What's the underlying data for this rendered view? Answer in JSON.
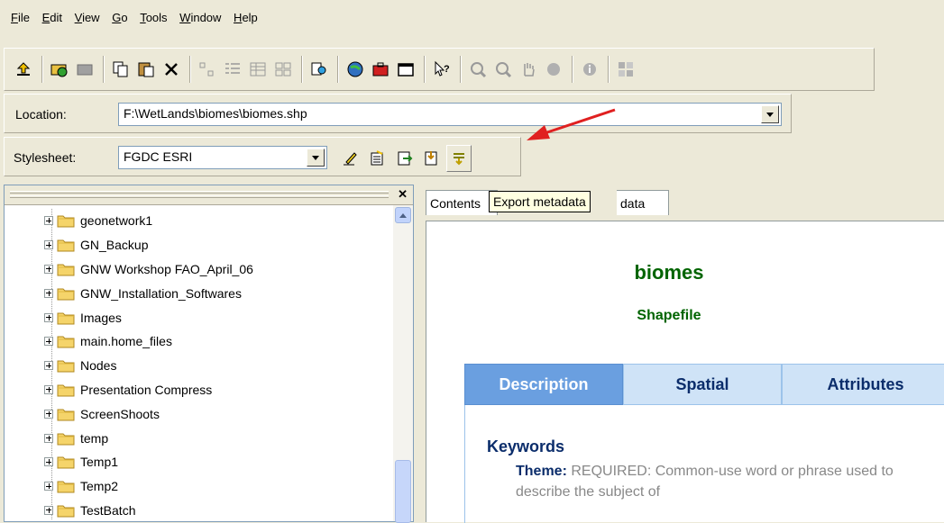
{
  "menu": [
    "File",
    "Edit",
    "View",
    "Go",
    "Tools",
    "Window",
    "Help"
  ],
  "location": {
    "label": "Location:",
    "value": "F:\\WetLands\\biomes\\biomes.shp"
  },
  "stylesheet": {
    "label": "Stylesheet:",
    "value": "FGDC ESRI"
  },
  "tooltip": "Export metadata",
  "tree": {
    "items": [
      "geonetwork1",
      "GN_Backup",
      "GNW Workshop FAO_April_06",
      "GNW_Installation_Softwares",
      "Images",
      "main.home_files",
      "Nodes",
      "Presentation Compress",
      "ScreenShoots",
      "temp",
      "Temp1",
      "Temp2",
      "TestBatch"
    ]
  },
  "tabs": {
    "contents": "Contents",
    "metadata_tail": "data"
  },
  "document": {
    "title": "biomes",
    "subtitle": "Shapefile",
    "tabs": [
      "Description",
      "Spatial",
      "Attributes"
    ],
    "section": "Keywords",
    "theme_label": "Theme:",
    "theme_text": "REQUIRED: Common-use word or phrase used to describe the subject of"
  },
  "colors": {
    "accent": "#6a9fe0",
    "title_green": "#006400",
    "arrow_red": "#e02020"
  }
}
